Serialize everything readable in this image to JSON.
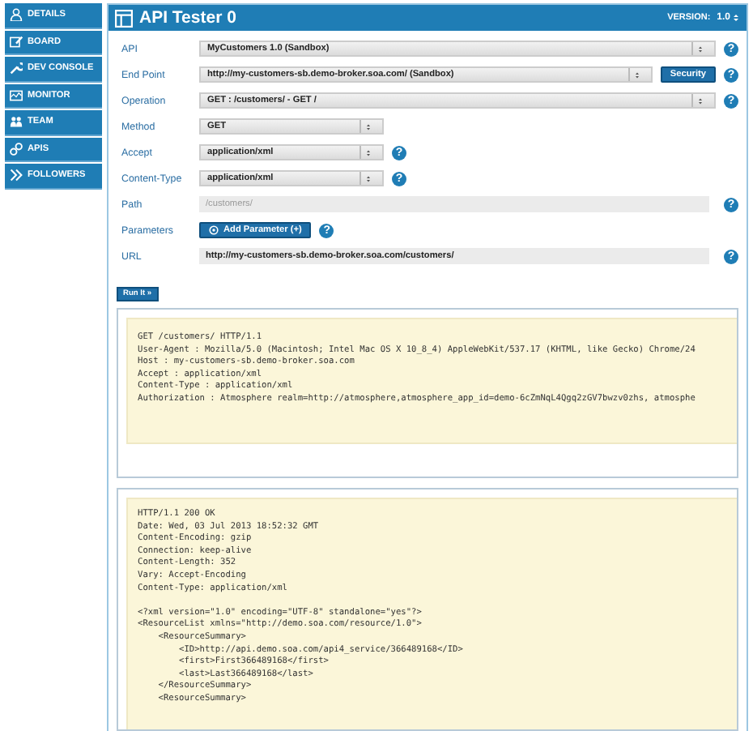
{
  "sidebar": {
    "items": [
      {
        "label": "DETAILS"
      },
      {
        "label": "BOARD"
      },
      {
        "label": "DEV CONSOLE"
      },
      {
        "label": "MONITOR"
      },
      {
        "label": "TEAM"
      },
      {
        "label": "APIS"
      },
      {
        "label": "FOLLOWERS"
      }
    ]
  },
  "header": {
    "title": "API Tester 0",
    "version_label": "VERSION:",
    "version": "1.0"
  },
  "form": {
    "rows": [
      {
        "label": "API",
        "kind": "select",
        "value": "MyCustomers 1.0 (Sandbox)",
        "help": "?"
      },
      {
        "label": "End Point",
        "kind": "select",
        "value": "http://my-customers-sb.demo-broker.soa.com/ (Sandbox)",
        "button": "Security",
        "help": "?"
      },
      {
        "label": "Operation",
        "kind": "select",
        "value": "GET : /customers/ - GET /",
        "help": "?"
      },
      {
        "label": "Method",
        "kind": "compact-select",
        "value": "GET"
      },
      {
        "label": "Accept",
        "kind": "compact-select",
        "value": "application/xml",
        "help": "?"
      },
      {
        "label": "Content-Type",
        "kind": "compact-select",
        "value": "application/xml",
        "help": "?"
      },
      {
        "label": "Path",
        "kind": "input",
        "placeholder": "/customers/",
        "help": "?"
      },
      {
        "label": "Parameters",
        "kind": "action",
        "button": "Add Parameter (+)",
        "help": "?"
      },
      {
        "label": "URL",
        "kind": "input",
        "value": "http://my-customers-sb.demo-broker.soa.com/customers/",
        "help": "?"
      }
    ]
  },
  "run_button": "Run It »",
  "request": {
    "lines": [
      "GET /customers/ HTTP/1.1",
      "User-Agent : Mozilla/5.0 (Macintosh; Intel Mac OS X 10_8_4) AppleWebKit/537.17 (KHTML, like Gecko) Chrome/24",
      "Host : my-customers-sb.demo-broker.soa.com",
      "Accept : application/xml",
      "Content-Type : application/xml",
      "Authorization : Atmosphere realm=http://atmosphere,atmosphere_app_id=demo-6cZmNqL4Qgq2zGV7bwzv0zhs, atmosphe"
    ]
  },
  "response": {
    "header_lines": [
      "HTTP/1.1 200 OK",
      "Date: Wed, 03 Jul 2013 18:52:32 GMT",
      "Content-Encoding: gzip",
      "Connection: keep-alive",
      "Content-Length: 352",
      "Vary: Accept-Encoding",
      "Content-Type: application/xml"
    ],
    "body_lines": [
      "<?xml version=\"1.0\" encoding=\"UTF-8\" standalone=\"yes\"?>",
      "<ResourceList xmlns=\"http://demo.soa.com/resource/1.0\">",
      "    <ResourceSummary>",
      "        <ID>http://api.demo.soa.com/api4_service/366489168</ID>",
      "        <first>First366489168</first>",
      "        <last>Last366489168</last>",
      "    </ResourceSummary>",
      "    <ResourceSummary>"
    ]
  }
}
